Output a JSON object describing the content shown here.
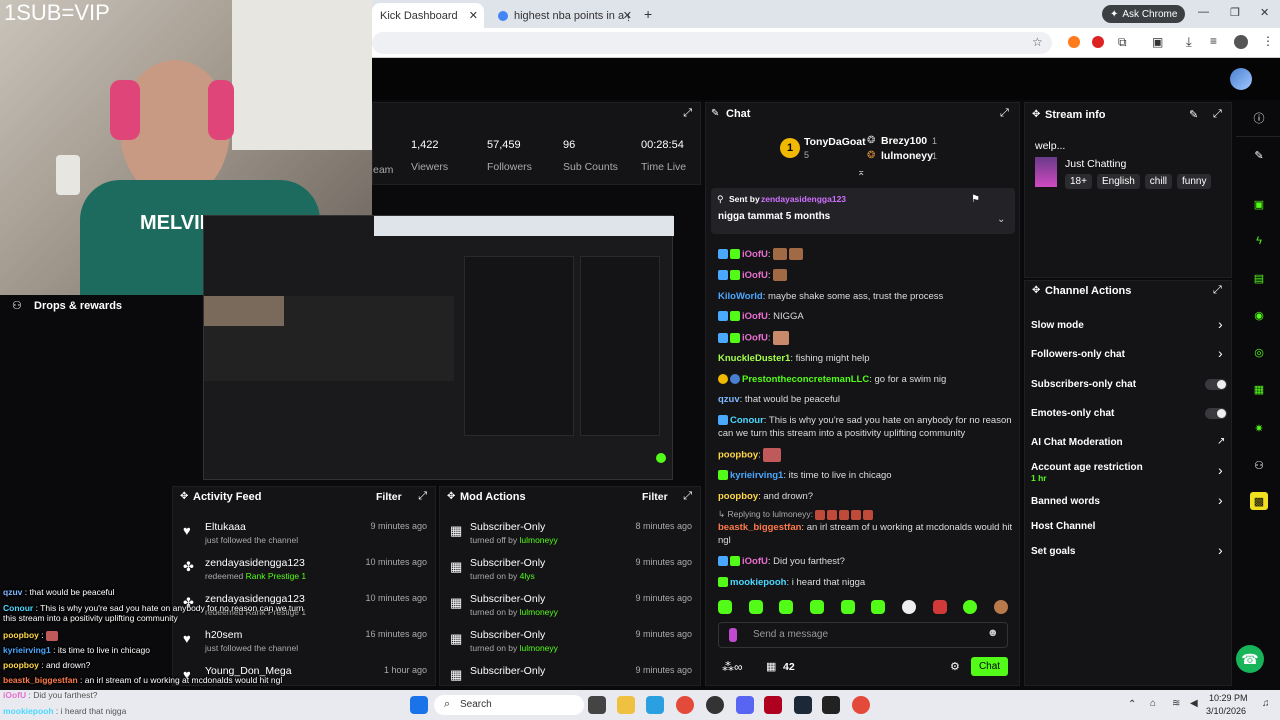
{
  "overlay_title": "1SUB=VIP",
  "browser": {
    "tabs": [
      {
        "label": "Kick Dashboard",
        "active": true
      },
      {
        "label": "highest nba points in a game b",
        "active": false
      }
    ],
    "ask_chrome": "Ask Chrome"
  },
  "stats": {
    "partial_label": "eam",
    "items": [
      {
        "value": "1,422",
        "label": "Viewers"
      },
      {
        "value": "57,459",
        "label": "Followers"
      },
      {
        "value": "96",
        "label": "Sub Counts"
      },
      {
        "value": "00:28:54",
        "label": "Time Live"
      }
    ]
  },
  "drops_label": "Drops & rewards",
  "activity": {
    "title": "Activity Feed",
    "filter": "Filter",
    "items": [
      {
        "name": "Eltukaaa",
        "sub": "just followed the channel",
        "time": "9 minutes ago"
      },
      {
        "name": "zendayasidengga123",
        "sub": "redeemed",
        "sub_highlight": "Rank Prestige 1",
        "time": "10 minutes ago"
      },
      {
        "name": "zendayasidengga123",
        "sub": "redeemed Rank Prestige 1",
        "time": "10 minutes ago"
      },
      {
        "name": "h20sem",
        "sub": "just followed the channel",
        "time": "16 minutes ago"
      },
      {
        "name": "Young_Don_Mega",
        "sub": "",
        "time": "1 hour ago"
      }
    ]
  },
  "mod": {
    "title": "Mod Actions",
    "filter": "Filter",
    "items": [
      {
        "name": "Subscriber-Only",
        "sub": "turned off by",
        "by": "lulmoneyy",
        "time": "8 minutes ago"
      },
      {
        "name": "Subscriber-Only",
        "sub": "turned on by",
        "by": "4lys",
        "time": "9 minutes ago"
      },
      {
        "name": "Subscriber-Only",
        "sub": "turned on by",
        "by": "lulmoneyy",
        "time": "9 minutes ago"
      },
      {
        "name": "Subscriber-Only",
        "sub": "turned on by",
        "by": "lulmoneyy",
        "time": "9 minutes ago"
      },
      {
        "name": "Subscriber-Only",
        "sub": "",
        "by": "",
        "time": "9 minutes ago"
      }
    ]
  },
  "chat": {
    "title": "Chat",
    "leaders": {
      "first": {
        "name": "TonyDaGoat",
        "count": "5"
      },
      "second": {
        "name": "Brezy100",
        "count": "1"
      },
      "third": {
        "name": "lulmoneyy",
        "count": "1"
      }
    },
    "pinned": {
      "sent_by_label": "Sent by",
      "sender": "zendayasidengga123",
      "message": "nigga tammat 5 months"
    },
    "messages": [
      {
        "user": "iOofU",
        "text": ":",
        "color": "#e86fd0"
      },
      {
        "user": "iOofU",
        "text": ":",
        "color": "#e86fd0"
      },
      {
        "user": "KiloWorld",
        "text": ": maybe shake some ass, trust the process",
        "color": "#4aa8ff"
      },
      {
        "user": "iOofU",
        "text": ": NIGGA",
        "color": "#e86fd0"
      },
      {
        "user": "iOofU",
        "text": ":",
        "color": "#e86fd0"
      },
      {
        "user": "KnuckleDuster1",
        "text": ": fishing might help",
        "color": "#a3ff4a"
      },
      {
        "user": "PrestontheconcretemanLLC",
        "text": ": go for a swim nig",
        "color": "#4aa8ff"
      },
      {
        "user": "qzuv",
        "text": ": that would be peaceful",
        "color": "#7fb8ff"
      },
      {
        "user": "Conour",
        "text": ": This is why you're sad you hate on anybody for no reason can we turn this stream into a positivity uplifting community",
        "color": "#4ad9ff"
      },
      {
        "user": "poopboy",
        "text": ":",
        "color": "#ffd84a"
      },
      {
        "user": "kyrieirving1",
        "text": ": its time to live in chicago",
        "color": "#4aa8ff"
      },
      {
        "user": "poopboy",
        "text": ": and drown?",
        "color": "#ffd84a"
      },
      {
        "user": "beastk_biggestfan",
        "text": ": an irl stream of u working at mcdonalds would hit ngl",
        "color": "#ff7a4a"
      },
      {
        "user": "iOofU",
        "text": ": Did you farthest?",
        "color": "#e86fd0"
      },
      {
        "user": "mookiepooh",
        "text": ": i heard that nigga",
        "color": "#4ad9ff"
      }
    ],
    "reply_label": "Replying to lulmoneyy:",
    "placeholder": "Send a message",
    "count": "42",
    "send": "Chat"
  },
  "stream_info": {
    "title": "Stream info",
    "stream_title": "welp...",
    "category": "Just Chatting",
    "tags": [
      "18+",
      "English",
      "chill",
      "funny"
    ]
  },
  "channel_actions": {
    "title": "Channel Actions",
    "items": [
      {
        "label": "Slow mode",
        "control": "chevron"
      },
      {
        "label": "Followers-only chat",
        "control": "chevron"
      },
      {
        "label": "Subscribers-only chat",
        "control": "toggle"
      },
      {
        "label": "Emotes-only chat",
        "control": "toggle"
      },
      {
        "label": "AI Chat Moderation",
        "control": "link"
      },
      {
        "label": "Account age restriction",
        "sub": "1 hr",
        "control": "chevron"
      },
      {
        "label": "Banned words",
        "control": "chevron"
      },
      {
        "label": "Host Channel",
        "control": "none"
      },
      {
        "label": "Set goals",
        "control": "chevron"
      }
    ]
  },
  "overlay_chat": [
    {
      "user": "qzuv",
      "text": " : that would be peaceful"
    },
    {
      "user": "Conour",
      "text": " : This is why you're sad you hate on anybody for no reason can we turn this stream into a positivity uplifting community"
    },
    {
      "user": "poopboy",
      "text": " :"
    },
    {
      "user": "kyrieirving1",
      "text": " : its time to live in chicago"
    },
    {
      "user": "poopboy",
      "text": " : and drown?"
    },
    {
      "user": "beastk_biggestfan",
      "text": " : an irl stream of u working at mcdonalds would hit ngl"
    },
    {
      "user": "iOofU",
      "text": " : Did you farthest?"
    },
    {
      "user": "mookiepooh",
      "text": " : i heard that nigga"
    }
  ],
  "taskbar": {
    "search": "Search",
    "time": "10:29 PM",
    "date": "3/10/2026"
  },
  "colors": {
    "accent": "#53fc18",
    "panel": "#141416",
    "bg": "#0a0a0c"
  }
}
